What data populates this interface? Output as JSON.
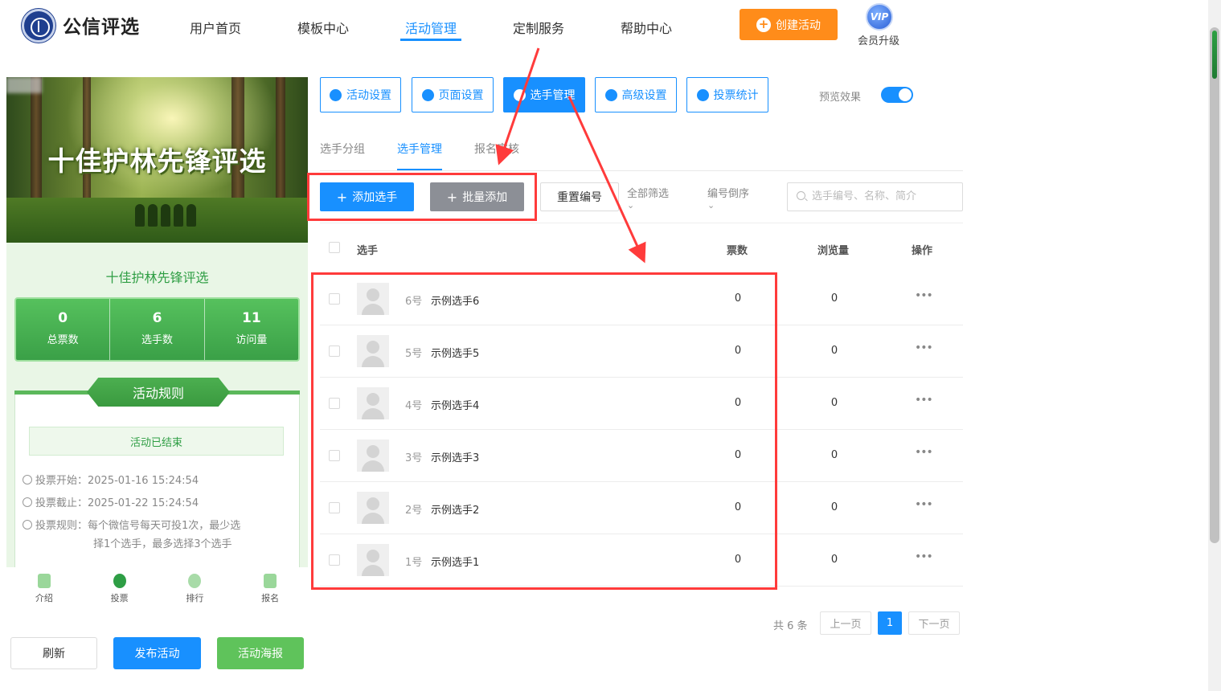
{
  "header": {
    "brand": "公信评选",
    "nav": [
      "用户首页",
      "模板中心",
      "活动管理",
      "定制服务",
      "帮助中心"
    ],
    "active_nav": "活动管理",
    "create_label": "创建活动",
    "vip_badge": "VIP",
    "vip_label": "会员升级"
  },
  "preview": {
    "banner_title": "十佳护林先锋评选",
    "title": "十佳护林先锋评选",
    "stats": [
      {
        "value": "0",
        "label": "总票数"
      },
      {
        "value": "6",
        "label": "选手数"
      },
      {
        "value": "11",
        "label": "访问量"
      }
    ],
    "rules_title": "活动规则",
    "status": "活动已结束",
    "vote_start_label": "投票开始：",
    "vote_start": "2025-01-16 15:24:54",
    "vote_end_label": "投票截止：",
    "vote_end": "2025-01-22 15:24:54",
    "rule_label": "投票规则：",
    "rule_text_1": "每个微信号每天可投1次，最少选",
    "rule_text_2": "择1个选手，最多选择3个选手",
    "tabs": [
      "介绍",
      "投票",
      "排行",
      "报名"
    ]
  },
  "bottom_buttons": {
    "refresh": "刷新",
    "publish": "发布活动",
    "poster": "活动海报"
  },
  "toolbar": {
    "buttons": [
      "活动设置",
      "页面设置",
      "选手管理",
      "高级设置",
      "投票统计"
    ],
    "active": "选手管理",
    "preview_label": "预览效果",
    "preview_on": true
  },
  "subtabs": [
    "选手分组",
    "选手管理",
    "报名审核"
  ],
  "actions": {
    "add": "添加选手",
    "batch_add": "批量添加",
    "reset_numbers": "重置编号",
    "filter_all": "全部筛选",
    "sort_desc": "编号倒序",
    "search_placeholder": "选手编号、名称、简介"
  },
  "table": {
    "headers": {
      "player": "选手",
      "votes": "票数",
      "views": "浏览量",
      "ops": "操作"
    },
    "rows": [
      {
        "num": "6号",
        "name": "示例选手6",
        "votes": "0",
        "views": "0"
      },
      {
        "num": "5号",
        "name": "示例选手5",
        "votes": "0",
        "views": "0"
      },
      {
        "num": "4号",
        "name": "示例选手4",
        "votes": "0",
        "views": "0"
      },
      {
        "num": "3号",
        "name": "示例选手3",
        "votes": "0",
        "views": "0"
      },
      {
        "num": "2号",
        "name": "示例选手2",
        "votes": "0",
        "views": "0"
      },
      {
        "num": "1号",
        "name": "示例选手1",
        "votes": "0",
        "views": "0"
      }
    ],
    "more_icon": "•••"
  },
  "pagination": {
    "total": "共 6 条",
    "prev": "上一页",
    "current": "1",
    "next": "下一页"
  },
  "colors": {
    "primary": "#1890ff",
    "orange": "#ff8c1a",
    "green": "#4caf50",
    "annotation": "#ff3b3b"
  }
}
